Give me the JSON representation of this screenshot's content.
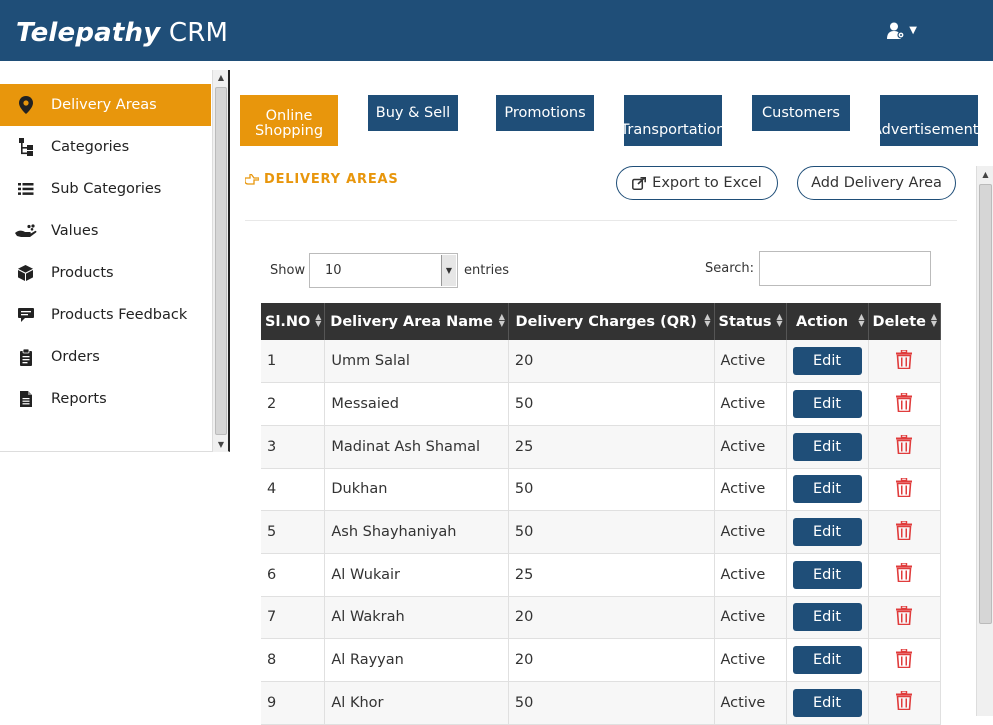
{
  "header": {
    "brand_bold": "Telepathy",
    "brand_rest": " CRM"
  },
  "sidebar": {
    "items": [
      {
        "label": "Delivery Areas",
        "icon": "map-marker-icon",
        "active": true
      },
      {
        "label": "Categories",
        "icon": "sitemap-icon"
      },
      {
        "label": "Sub Categories",
        "icon": "list-icon"
      },
      {
        "label": "Values",
        "icon": "hand-coins-icon"
      },
      {
        "label": "Products",
        "icon": "cube-icon"
      },
      {
        "label": "Products Feedback",
        "icon": "comment-icon"
      },
      {
        "label": "Orders",
        "icon": "clipboard-icon"
      },
      {
        "label": "Reports",
        "icon": "file-text-icon"
      }
    ]
  },
  "tabs": [
    {
      "label": "Online Shopping",
      "active": true
    },
    {
      "label": "Buy & Sell"
    },
    {
      "label": "Promotions"
    },
    {
      "label": "Transportation"
    },
    {
      "label": "Customers"
    },
    {
      "label": "Advertisements"
    }
  ],
  "content": {
    "section_title": "DELIVERY AREAS",
    "export_label": "Export to Excel",
    "add_label": "Add Delivery Area",
    "show_label": "Show",
    "page_size": "10",
    "entries_label": "entries",
    "search_label": "Search:"
  },
  "table": {
    "columns": [
      "Sl.NO",
      "Delivery Area Name",
      "Delivery Charges (QR)",
      "Status",
      "Action",
      "Delete"
    ],
    "edit_label": "Edit",
    "rows": [
      {
        "sl": "1",
        "name": "Umm Salal",
        "charge": "20",
        "status": "Active"
      },
      {
        "sl": "2",
        "name": "Messaied",
        "charge": "50",
        "status": "Active"
      },
      {
        "sl": "3",
        "name": "Madinat Ash Shamal",
        "charge": "25",
        "status": "Active"
      },
      {
        "sl": "4",
        "name": "Dukhan",
        "charge": "50",
        "status": "Active"
      },
      {
        "sl": "5",
        "name": "Ash Shayhaniyah",
        "charge": "50",
        "status": "Active"
      },
      {
        "sl": "6",
        "name": "Al Wukair",
        "charge": "25",
        "status": "Active"
      },
      {
        "sl": "7",
        "name": "Al Wakrah",
        "charge": "20",
        "status": "Active"
      },
      {
        "sl": "8",
        "name": "Al Rayyan",
        "charge": "20",
        "status": "Active"
      },
      {
        "sl": "9",
        "name": "Al Khor",
        "charge": "50",
        "status": "Active"
      }
    ]
  },
  "colors": {
    "primary": "#1f4e78",
    "accent": "#e8960c",
    "danger": "#e03c3c"
  }
}
